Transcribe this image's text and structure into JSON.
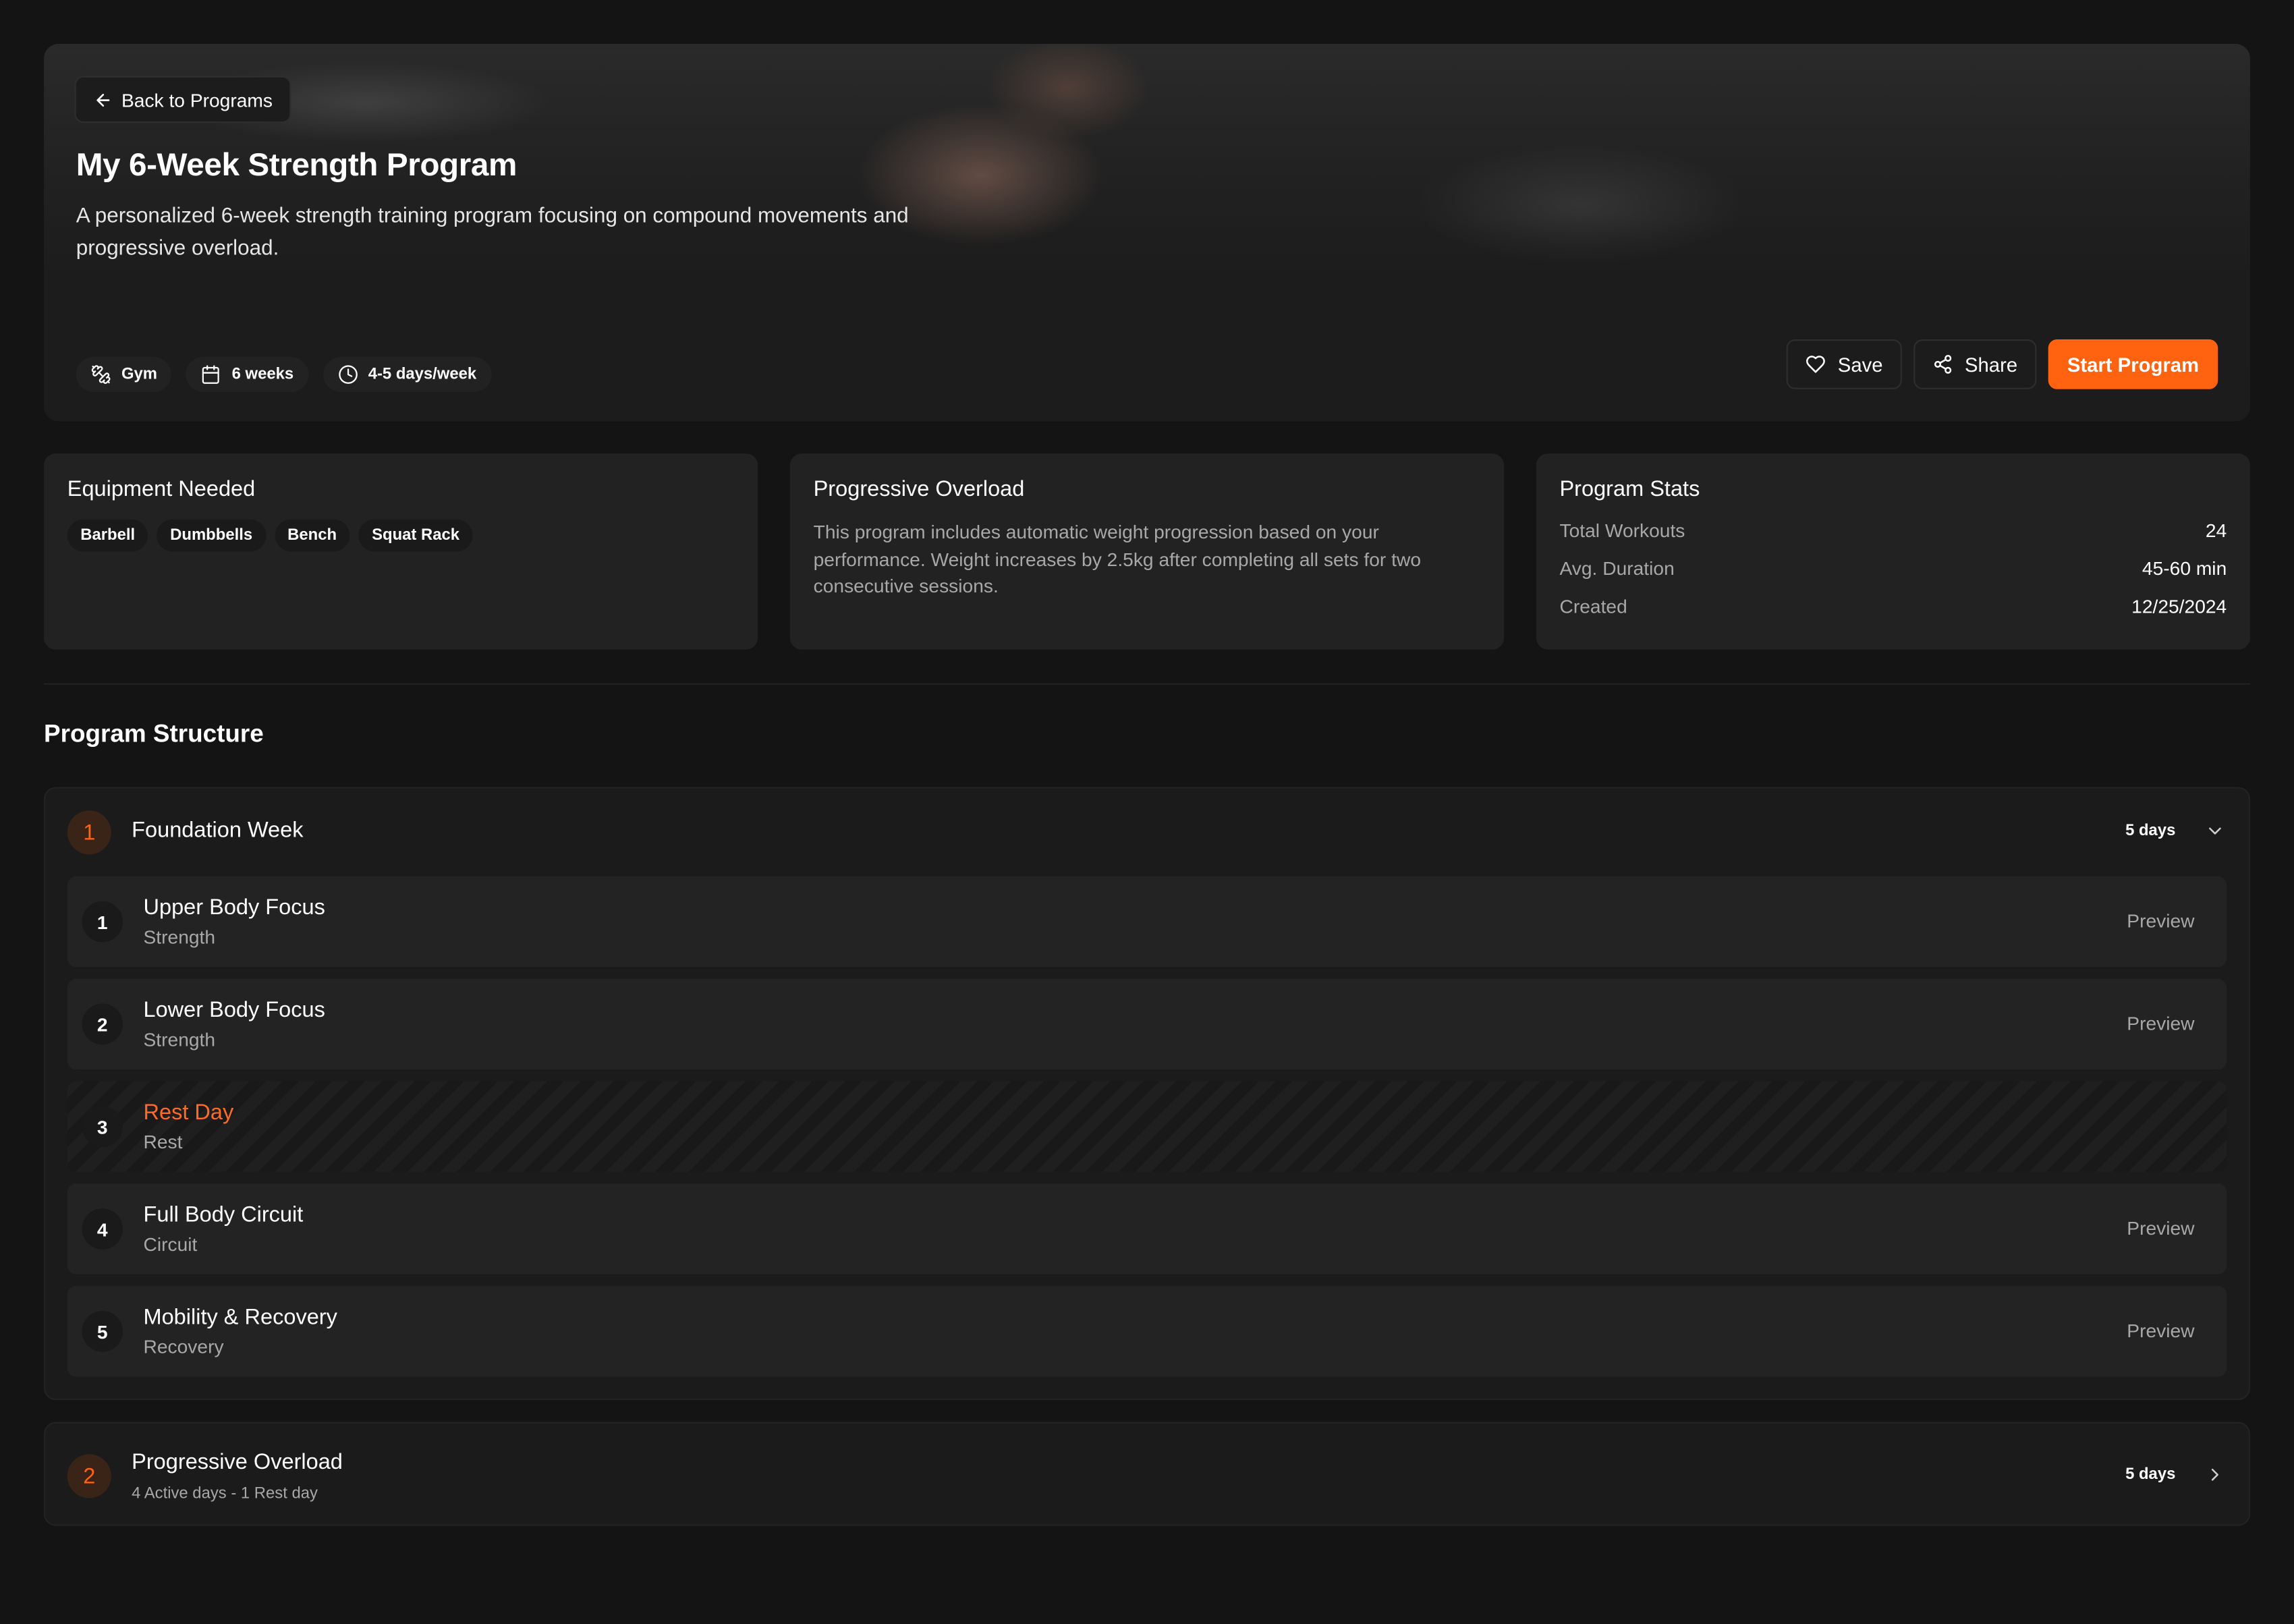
{
  "hero": {
    "back_label": "Back to Programs",
    "title": "My 6-Week Strength Program",
    "description": "A personalized 6-week strength training program focusing on compound movements and progressive overload.",
    "tags": [
      {
        "icon": "dumbbell-icon",
        "label": "Gym"
      },
      {
        "icon": "calendar-icon",
        "label": "6 weeks"
      },
      {
        "icon": "clock-icon",
        "label": "4-5 days/week"
      }
    ],
    "actions": {
      "save": "Save",
      "share": "Share",
      "start": "Start Program"
    }
  },
  "equipment": {
    "title": "Equipment Needed",
    "items": [
      "Barbell",
      "Dumbbells",
      "Bench",
      "Squat Rack"
    ]
  },
  "overload": {
    "title": "Progressive Overload",
    "text": "This program includes automatic weight progression based on your performance. Weight increases by 2.5kg after completing all sets for two consecutive sessions."
  },
  "stats": {
    "title": "Program Stats",
    "rows": [
      {
        "key": "Total Workouts",
        "value": "24"
      },
      {
        "key": "Avg. Duration",
        "value": "45-60 min"
      },
      {
        "key": "Created",
        "value": "12/25/2024"
      }
    ]
  },
  "structure": {
    "title": "Program Structure",
    "weeks": [
      {
        "num": "1",
        "title": "Foundation Week",
        "days_label": "5 days",
        "expanded": true,
        "days": [
          {
            "num": "1",
            "title": "Upper Body Focus",
            "type": "Strength",
            "action": "Preview"
          },
          {
            "num": "2",
            "title": "Lower Body Focus",
            "type": "Strength",
            "action": "Preview"
          },
          {
            "num": "3",
            "title": "Rest Day",
            "type": "Rest",
            "action": ""
          },
          {
            "num": "4",
            "title": "Full Body Circuit",
            "type": "Circuit",
            "action": "Preview"
          },
          {
            "num": "5",
            "title": "Mobility & Recovery",
            "type": "Recovery",
            "action": "Preview"
          }
        ]
      },
      {
        "num": "2",
        "title": "Progressive Overload",
        "subtitle": "4 Active days - 1 Rest day",
        "days_label": "5 days",
        "expanded": false
      }
    ]
  },
  "colors": {
    "accent": "#ff6310",
    "background": "#141414",
    "card": "#222222"
  }
}
